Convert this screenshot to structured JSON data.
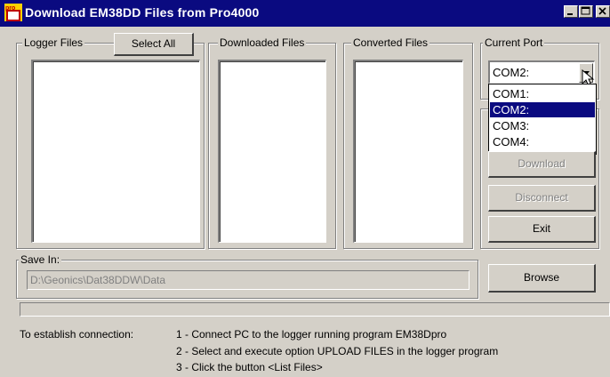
{
  "window": {
    "title": "Download EM38DD Files from Pro4000",
    "icon": "pro-app-icon"
  },
  "groups": {
    "logger_files": "Logger Files",
    "downloaded_files": "Downloaded Files",
    "converted_files": "Converted Files",
    "current_port": "Current Port",
    "save_in": "Save In:"
  },
  "buttons": {
    "select_all": "Select All",
    "download": "Download",
    "disconnect": "Disconnect",
    "exit": "Exit",
    "browse": "Browse"
  },
  "port": {
    "selected": "COM2:",
    "options": [
      "COM1:",
      "COM2:",
      "COM3:",
      "COM4:"
    ],
    "highlighted_index": 1
  },
  "save_in_path": "D:\\Geonics\\Dat38DDW\\Data",
  "progress": 0,
  "instructions": {
    "intro": "To establish connection:",
    "steps": [
      "1  -  Connect PC to the logger running program EM38Dpro",
      "2  -  Select and execute option UPLOAD FILES in the logger program",
      "3  -  Click the button <List Files>"
    ]
  },
  "colors": {
    "titlebar": "#0a0a80",
    "face": "#d4d0c8",
    "selection": "#0a0a80"
  }
}
